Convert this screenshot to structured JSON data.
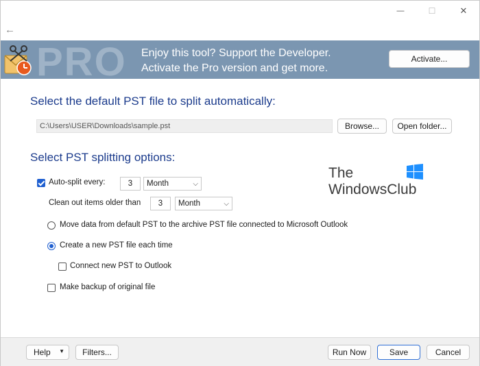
{
  "window": {
    "minimize_glyph": "—",
    "maximize_glyph": "☐",
    "close_glyph": "✕",
    "back_glyph": "←"
  },
  "banner": {
    "pro_text": "PRO",
    "line1": "Enjoy this tool? Support the Developer.",
    "line2": "Activate the Pro version and get more.",
    "activate_label": "Activate...",
    "bg_color": "#7b96b1"
  },
  "pst_section": {
    "title": "Select the default PST file to split automatically:",
    "path": "C:\\Users\\USER\\Downloads\\sample.pst",
    "browse_label": "Browse...",
    "open_folder_label": "Open folder..."
  },
  "options_section": {
    "title": "Select PST splitting options:",
    "auto_split": {
      "label": "Auto-split every:",
      "checked": true,
      "value": "3",
      "unit": "Month"
    },
    "clean_out": {
      "label": "Clean out items older than",
      "value": "3",
      "unit": "Month"
    },
    "radio_move": {
      "label": "Move data from default PST to the archive PST file connected to Microsoft Outlook",
      "selected": false
    },
    "radio_create": {
      "label": "Create a new PST file each time",
      "selected": true
    },
    "connect_new": {
      "label": "Connect new PST to Outlook",
      "checked": false
    },
    "make_backup": {
      "label": "Make backup of original file",
      "checked": false
    }
  },
  "watermark": {
    "line1": "The",
    "line2": "WindowsClub"
  },
  "footer": {
    "help_label": "Help",
    "filters_label": "Filters...",
    "run_now_label": "Run Now",
    "save_label": "Save",
    "cancel_label": "Cancel"
  },
  "colors": {
    "accent": "#1f5fd0",
    "heading": "#1b3b8c"
  }
}
